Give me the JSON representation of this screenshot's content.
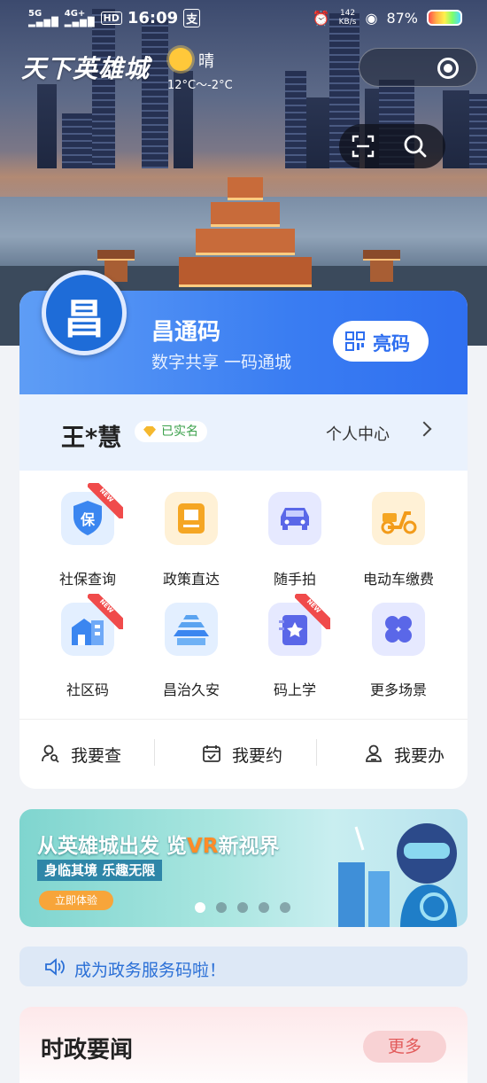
{
  "status_bar": {
    "network": "5G",
    "network2": "4G+",
    "hd": "HD",
    "time": "16:09",
    "notif": "支",
    "speed_value": "142",
    "speed_unit": "KB/s",
    "battery": "87%"
  },
  "header": {
    "brand": "天下英雄城",
    "weather": {
      "desc": "晴",
      "temp": "12°C～-2°C"
    }
  },
  "code_card": {
    "logo_glyph": "昌",
    "title": "昌通码",
    "subtitle": "数字共享 一码通城",
    "show_button": "亮码"
  },
  "user": {
    "name": "王*慧",
    "verified": "已实名",
    "center_link": "个人中心"
  },
  "services": [
    {
      "label": "社保查询",
      "icon": "social-security-icon",
      "new": true,
      "badge": "NEW"
    },
    {
      "label": "政策直达",
      "icon": "policy-icon",
      "new": false
    },
    {
      "label": "随手拍",
      "icon": "car-icon",
      "new": false
    },
    {
      "label": "电动车缴费",
      "icon": "scooter-icon",
      "new": false
    },
    {
      "label": "社区码",
      "icon": "community-icon",
      "new": true,
      "badge": "NEW"
    },
    {
      "label": "昌治久安",
      "icon": "pagoda-icon",
      "new": false
    },
    {
      "label": "码上学",
      "icon": "learn-icon",
      "new": true,
      "badge": "NEW"
    },
    {
      "label": "更多场景",
      "icon": "more-scenes-icon",
      "new": false
    }
  ],
  "quick_actions": [
    {
      "label": "我要查",
      "icon": "person-search-icon"
    },
    {
      "label": "我要约",
      "icon": "calendar-check-icon"
    },
    {
      "label": "我要办",
      "icon": "person-task-icon"
    }
  ],
  "banner": {
    "title_pre": "从英雄城出发 览",
    "title_vr": "VR",
    "title_post": "新视界",
    "subtitle": "身临其境 乐趣无限",
    "button": "立即体验",
    "slides": 5,
    "active_slide": 1
  },
  "notice": {
    "text": "成为政务服务码啦！"
  },
  "news": {
    "title": "时政要闻",
    "more": "更多"
  },
  "colors": {
    "primary": "#2f6ff0",
    "accent_red": "#e25b5b",
    "verified_green": "#3aa04a"
  }
}
